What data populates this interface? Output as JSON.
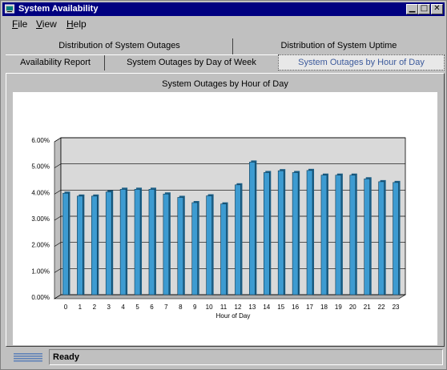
{
  "window": {
    "title": "System Availability"
  },
  "menu": {
    "file": "File",
    "view": "View",
    "help": "Help"
  },
  "tabs": {
    "row1": [
      "Distribution of System Outages",
      "Distribution of System Uptime"
    ],
    "row2": [
      "Availability Report",
      "System Outages by Day of Week",
      "System Outages by Hour of Day"
    ],
    "active": "System Outages by Hour of Day"
  },
  "status": {
    "text": "Ready",
    "logo": "IBM"
  },
  "chart_data": {
    "type": "bar",
    "title": "System Outages by Hour of Day",
    "xlabel": "Hour of Day",
    "ylabel": "",
    "categories": [
      "0",
      "1",
      "2",
      "3",
      "4",
      "5",
      "6",
      "7",
      "8",
      "9",
      "10",
      "11",
      "12",
      "13",
      "14",
      "15",
      "16",
      "17",
      "18",
      "19",
      "20",
      "21",
      "22",
      "23"
    ],
    "values": [
      3.88,
      3.77,
      3.77,
      3.93,
      4.03,
      4.03,
      4.03,
      3.85,
      3.72,
      3.52,
      3.78,
      3.47,
      4.2,
      5.07,
      4.67,
      4.74,
      4.67,
      4.75,
      4.57,
      4.57,
      4.57,
      4.43,
      4.32,
      4.29
    ],
    "ylim": [
      0,
      6
    ],
    "yticks": [
      "0.00%",
      "1.00%",
      "2.00%",
      "3.00%",
      "4.00%",
      "5.00%",
      "6.00%"
    ],
    "grid": true,
    "legend": "none",
    "colors": {
      "bar": "#3d9bd1",
      "plot_bg": "#d9d9d9"
    }
  }
}
